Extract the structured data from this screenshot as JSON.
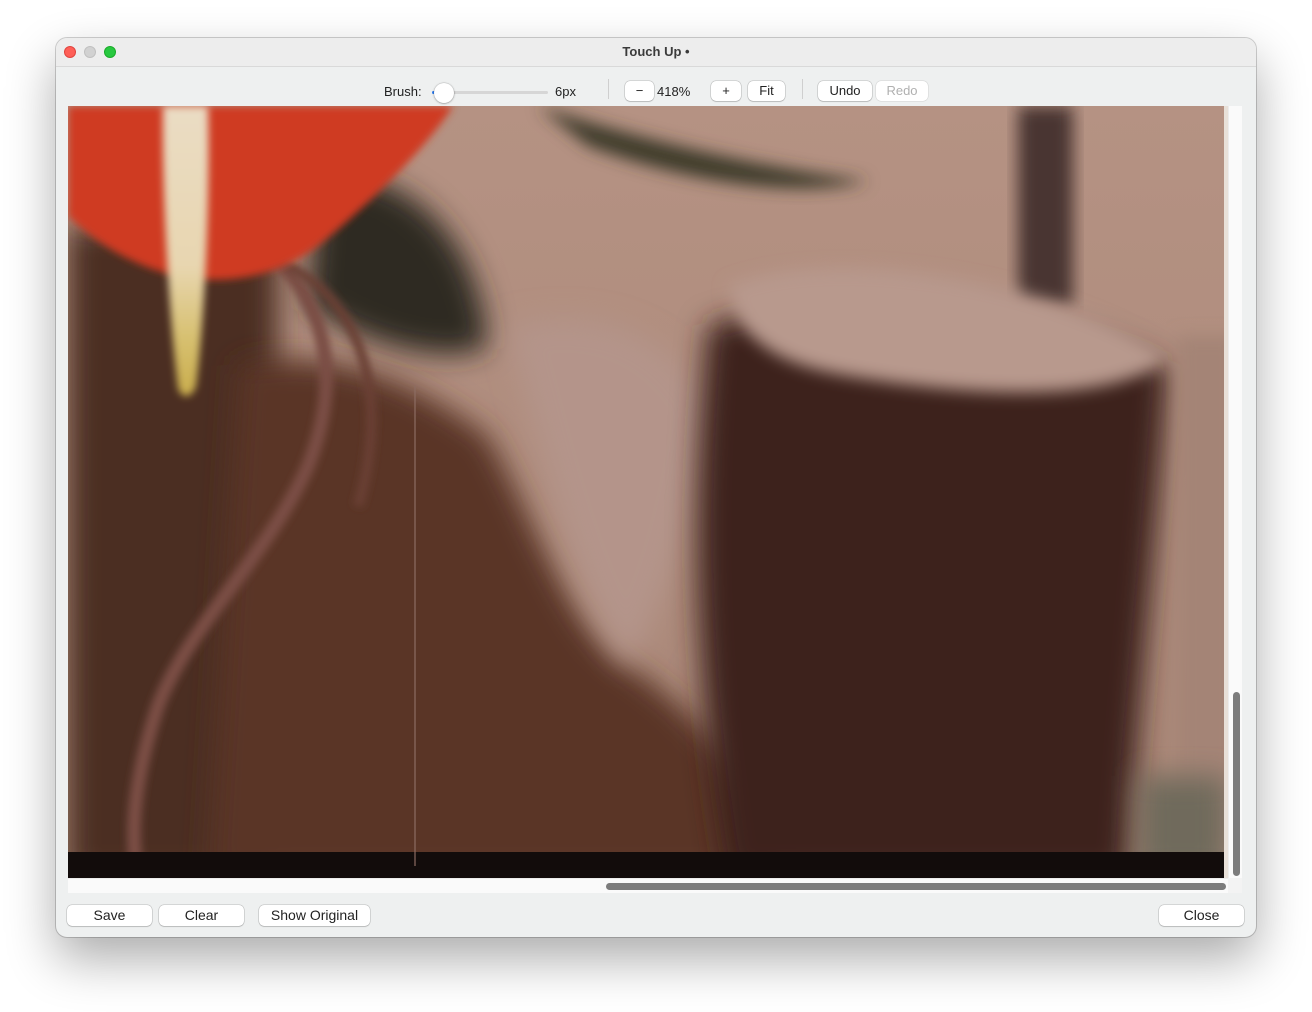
{
  "window": {
    "title": "Touch Up •"
  },
  "toolbar": {
    "brush_label": "Brush:",
    "brush_size": "6px",
    "brush_value_fraction": 0.1,
    "zoom_out_label": "−",
    "zoom_level": "418%",
    "zoom_in_label": "+",
    "fit_label": "Fit",
    "undo_label": "Undo",
    "redo_label": "Redo"
  },
  "footer": {
    "save_label": "Save",
    "clear_label": "Clear",
    "show_original_label": "Show Original",
    "close_label": "Close"
  },
  "colors": {
    "accent": "#2f7ff5",
    "close_light": "#fe5f57",
    "min_light": "#d1d1d1",
    "zoom_light": "#28c840"
  },
  "icons": {
    "close": "close-icon",
    "minimize": "minimize-icon",
    "zoom": "zoom-icon"
  }
}
